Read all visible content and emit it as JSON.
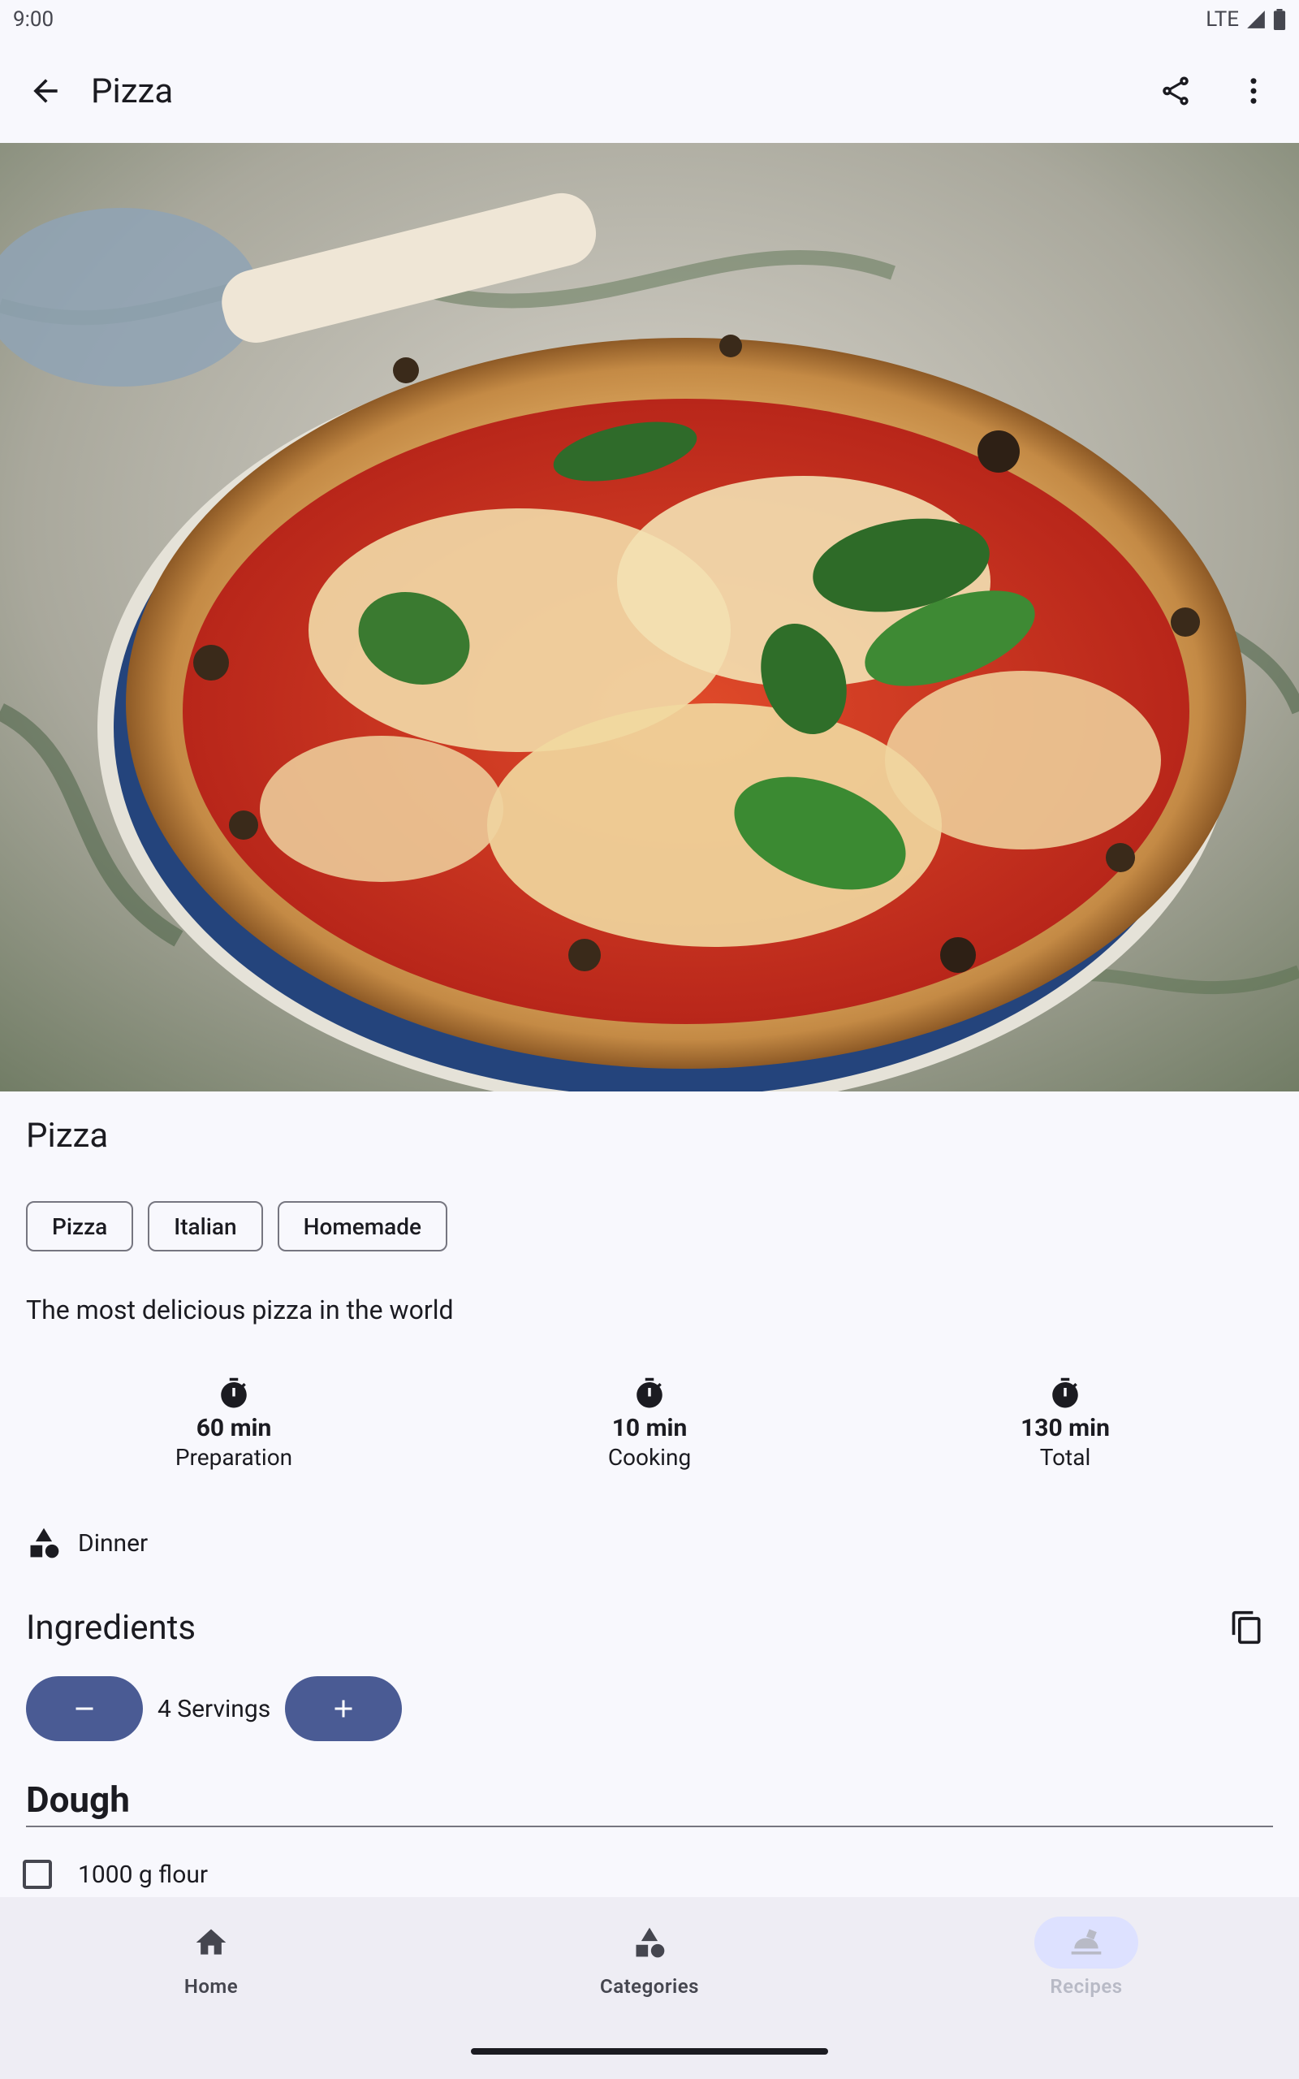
{
  "status_bar": {
    "time": "9:00",
    "network": "LTE"
  },
  "app_bar": {
    "title": "Pizza",
    "icons": [
      "arrow-back-icon",
      "share-icon",
      "more-vert-icon"
    ]
  },
  "recipe": {
    "title": "Pizza",
    "tags": [
      "Pizza",
      "Italian",
      "Homemade"
    ],
    "description": "The most delicious pizza in the world",
    "times": [
      {
        "value": "60 min",
        "label": "Preparation"
      },
      {
        "value": "10 min",
        "label": "Cooking"
      },
      {
        "value": "130 min",
        "label": "Total"
      }
    ],
    "category": "Dinner"
  },
  "ingredients": {
    "title": "Ingredients",
    "servings_label": "4 Servings",
    "sections": [
      {
        "title": "Dough",
        "items": [
          {
            "text": "1000 g flour",
            "checked": false
          }
        ]
      }
    ]
  },
  "bottom_nav": {
    "items": [
      {
        "label": "Home",
        "icon": "home-icon",
        "enabled": true
      },
      {
        "label": "Categories",
        "icon": "category-icon",
        "enabled": true
      },
      {
        "label": "Recipes",
        "icon": "recipes-icon",
        "enabled": false,
        "selected": true
      }
    ]
  },
  "colors": {
    "primary": "#4a5b94",
    "background": "#f8f8fd",
    "nav_background": "#eeedf4",
    "nav_indicator": "#dde1ff"
  }
}
